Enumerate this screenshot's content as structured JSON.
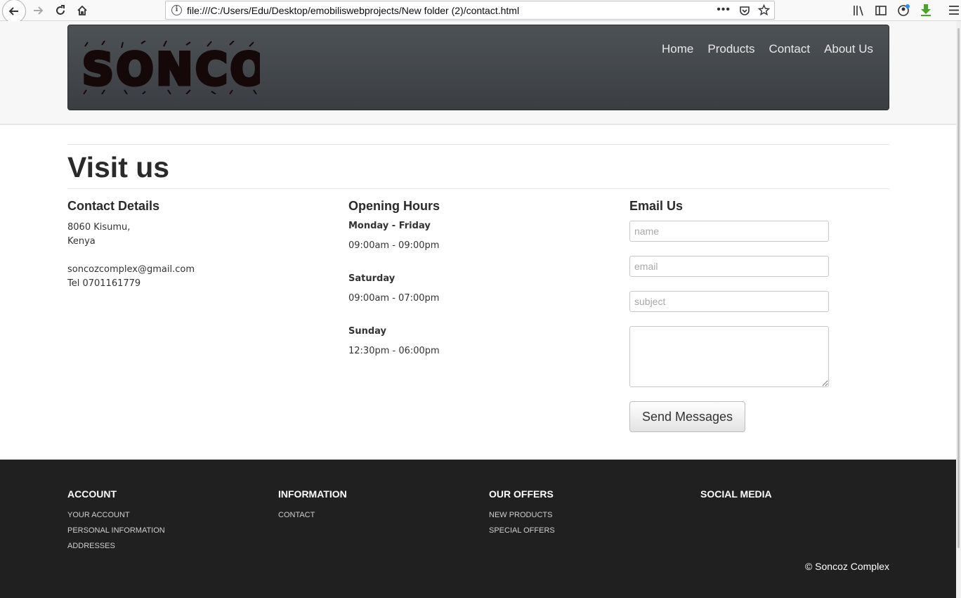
{
  "browser": {
    "url": "file:///C:/Users/Edu/Desktop/emobiliswebprojects/New folder (2)/contact.html"
  },
  "brand": {
    "logo_text": "SONCOZ"
  },
  "nav": [
    "Home",
    "Products",
    "Contact",
    "About Us"
  ],
  "page": {
    "title": "Visit us",
    "contact": {
      "heading": "Contact Details",
      "address_line1": "8060 Kisumu,",
      "address_line2": "Kenya",
      "email": "soncozcomplex@gmail.com",
      "phone": "Tel 0701161779"
    },
    "hours": {
      "heading": "Opening Hours",
      "items": [
        {
          "day": "Monday - Friday",
          "time": "09:00am - 09:00pm"
        },
        {
          "day": "Saturday",
          "time": "09:00am - 07:00pm"
        },
        {
          "day": "Sunday",
          "time": "12:30pm - 06:00pm"
        }
      ]
    },
    "email_form": {
      "heading": "Email Us",
      "name_placeholder": "name",
      "email_placeholder": "email",
      "subject_placeholder": "subject",
      "message_value": "",
      "send_label": "Send Messages"
    }
  },
  "footer": {
    "account": {
      "heading": "ACCOUNT",
      "links": [
        "YOUR ACCOUNT",
        "PERSONAL INFORMATION",
        "ADDRESSES"
      ]
    },
    "information": {
      "heading": "INFORMATION",
      "links": [
        "CONTACT"
      ]
    },
    "offers": {
      "heading": "OUR OFFERS",
      "links": [
        "NEW PRODUCTS",
        "SPECIAL OFFERS"
      ]
    },
    "social": {
      "heading": "SOCIAL MEDIA"
    },
    "copyright": "© Soncoz Complex"
  },
  "colors": {
    "navbar_top": "#4d5256",
    "navbar_bottom": "#3a3e42",
    "footer_bg": "#202020"
  }
}
